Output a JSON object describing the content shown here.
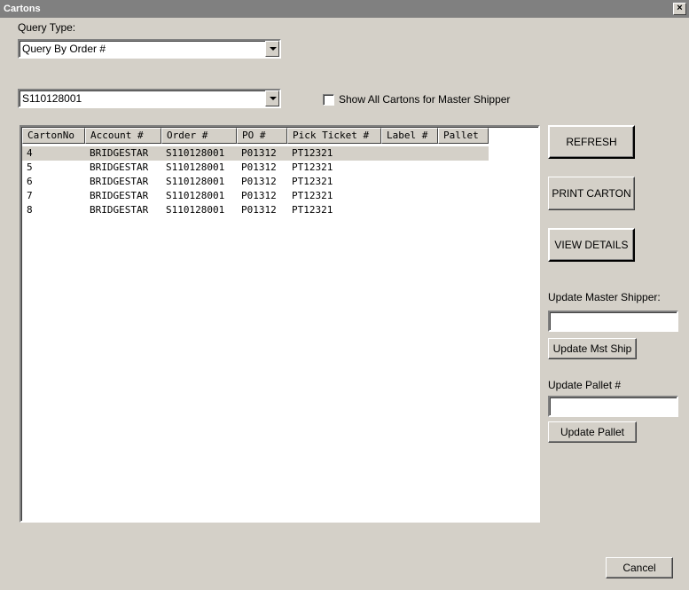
{
  "window": {
    "title": "Cartons",
    "close_icon": "×"
  },
  "query_type": {
    "label": "Query Type:",
    "selected": "Query By Order #"
  },
  "order": {
    "selected": "S110128001"
  },
  "show_all": {
    "label": "Show All Cartons for Master Shipper",
    "checked": false
  },
  "grid": {
    "columns": [
      "CartonNo",
      "Account #",
      "Order #",
      "PO #",
      "Pick Ticket #",
      "Label #",
      "Pallet"
    ],
    "rows": [
      [
        "4",
        "BRIDGESTAR",
        "S110128001",
        "P01312",
        "PT12321",
        "",
        ""
      ],
      [
        "5",
        "BRIDGESTAR",
        "S110128001",
        "P01312",
        "PT12321",
        "",
        ""
      ],
      [
        "6",
        "BRIDGESTAR",
        "S110128001",
        "P01312",
        "PT12321",
        "",
        ""
      ],
      [
        "7",
        "BRIDGESTAR",
        "S110128001",
        "P01312",
        "PT12321",
        "",
        ""
      ],
      [
        "8",
        "BRIDGESTAR",
        "S110128001",
        "P01312",
        "PT12321",
        "",
        ""
      ]
    ]
  },
  "actions": {
    "refresh": "REFRESH",
    "print_carton": "PRINT CARTON",
    "view_details": "VIEW DETAILS",
    "update_master_label": "Update Master Shipper:",
    "update_master_value": "",
    "update_mst_ship": "Update Mst Ship",
    "update_pallet_label": "Update Pallet #",
    "update_pallet_value": "",
    "update_pallet": "Update Pallet",
    "cancel": "Cancel"
  }
}
